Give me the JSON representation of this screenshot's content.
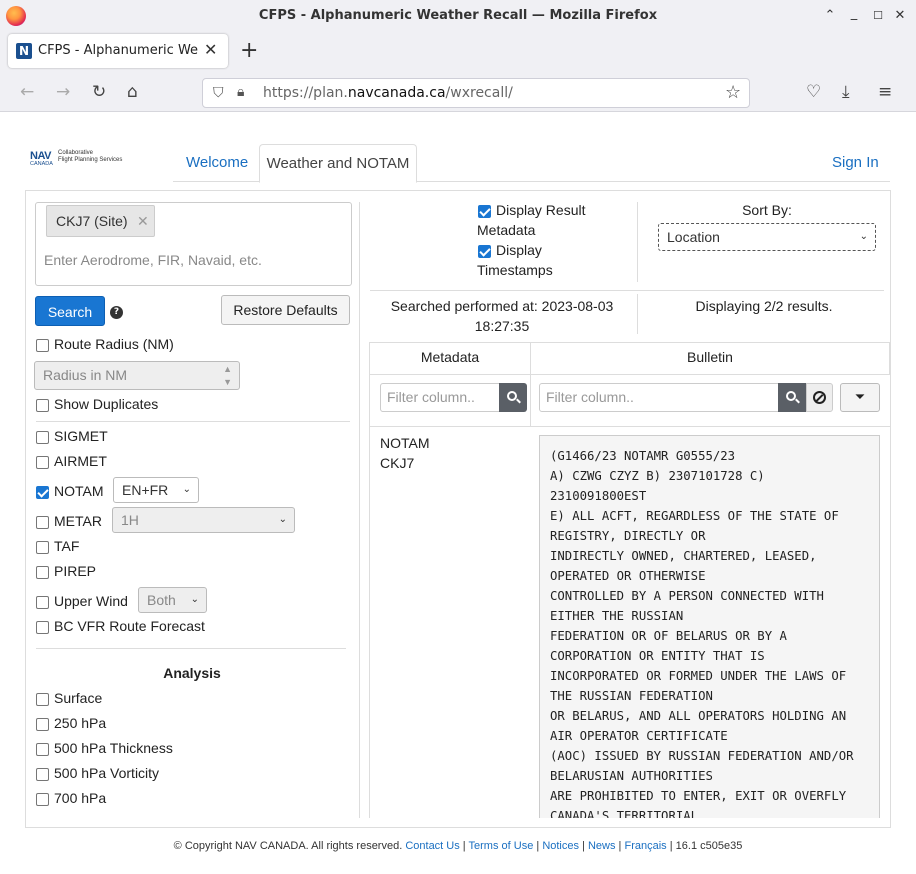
{
  "browser": {
    "window_title": "CFPS - Alphanumeric Weather Recall — Mozilla Firefox",
    "tab_title": "CFPS - Alphanumeric Weather Recall",
    "tab_favicon": "N",
    "url_prefix": "https://plan.",
    "url_domain": "navcanada.ca",
    "url_path": "/wxrecall/"
  },
  "site": {
    "logo_text": "NAV",
    "logo_sub": "CANADA",
    "logo_tag1": "Collaborative",
    "logo_tag2": "Flight Planning Services",
    "nav": {
      "welcome": "Welcome",
      "weather_notam": "Weather and NOTAM",
      "sign_in": "Sign In"
    }
  },
  "search": {
    "chip": "CKJ7 (Site)",
    "placeholder": "Enter Aerodrome, FIR, Navaid, etc.",
    "search_button": "Search",
    "restore_button": "Restore Defaults",
    "route_radius_label": "Route Radius (NM)",
    "radius_placeholder": "Radius in NM",
    "show_duplicates_label": "Show Duplicates"
  },
  "products": {
    "sigmet": "SIGMET",
    "airmet": "AIRMET",
    "notam": "NOTAM",
    "notam_lang": "EN+FR",
    "metar": "METAR",
    "metar_period": "1H",
    "taf": "TAF",
    "pirep": "PIREP",
    "upper_wind": "Upper Wind",
    "upper_wind_opt": "Both",
    "bc_vfr": "BC VFR Route Forecast"
  },
  "analysis": {
    "heading": "Analysis",
    "items": [
      "Surface",
      "250 hPa",
      "500 hPa Thickness",
      "500 hPa Vorticity",
      "700 hPa"
    ]
  },
  "results": {
    "display_metadata": "Display Result Metadata",
    "display_metadata_l1": "Display Result",
    "display_metadata_l2": "Metadata",
    "display_timestamps_l1": "Display",
    "display_timestamps_l2": "Timestamps",
    "sort_by_label": "Sort By:",
    "sort_by_value": "Location",
    "searched_line1": "Searched performed at: 2023-08-03",
    "searched_line2": "18:27:35",
    "displaying": "Displaying 2/2 results.",
    "col_metadata": "Metadata",
    "col_bulletin": "Bulletin",
    "filter_placeholder": "Filter column..",
    "row_type": "NOTAM",
    "row_site": "CKJ7",
    "bulletin_lines": [
      "(G1466/23 NOTAMR G0555/23",
      "A) CZWG CZYZ B) 2307101728 C)",
      "2310091800EST",
      "E) ALL ACFT, REGARDLESS OF THE STATE OF",
      "REGISTRY, DIRECTLY OR",
      "INDIRECTLY OWNED, CHARTERED, LEASED,",
      "OPERATED OR OTHERWISE",
      "CONTROLLED BY A PERSON CONNECTED WITH",
      "EITHER THE RUSSIAN",
      "FEDERATION OR OF BELARUS OR BY A",
      "CORPORATION OR ENTITY THAT IS",
      "INCORPORATED OR FORMED UNDER THE LAWS OF",
      "THE RUSSIAN FEDERATION",
      "OR BELARUS, AND ALL OPERATORS HOLDING AN",
      "AIR OPERATOR CERTIFICATE",
      "(AOC) ISSUED BY RUSSIAN FEDERATION AND/OR",
      "BELARUSIAN AUTHORITIES",
      "ARE PROHIBITED TO ENTER, EXIT OR OVERFLY",
      "CANADA'S TERRITORIAL"
    ]
  },
  "footer": {
    "copyright": "© Copyright NAV CANADA. All rights reserved.",
    "contact": "Contact Us",
    "terms": "Terms of Use",
    "notices": "Notices",
    "news": "News",
    "francais": "Français",
    "version": "16.1 c505e35"
  },
  "colors": {
    "primary": "#1976d2",
    "link": "#1a6fc1"
  }
}
